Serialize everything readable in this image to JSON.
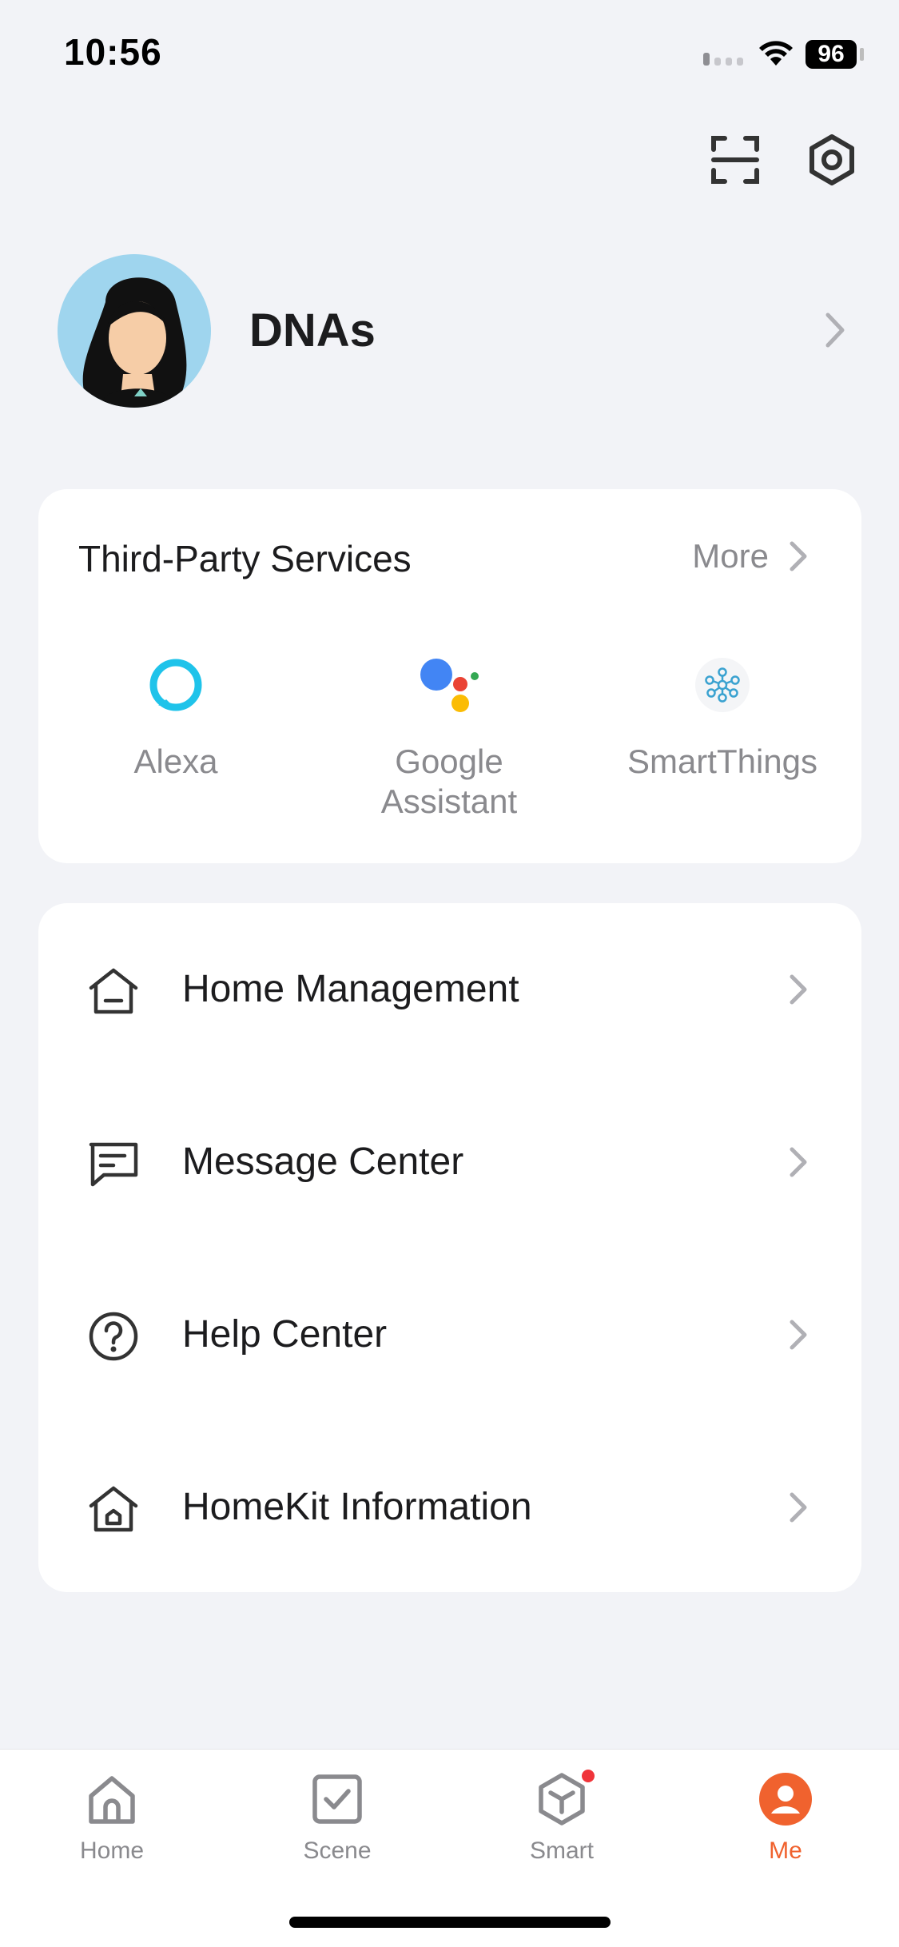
{
  "status_bar": {
    "time": "10:56",
    "battery": "96"
  },
  "profile": {
    "name": "DNAs"
  },
  "third_party": {
    "title": "Third-Party Services",
    "more_label": "More",
    "services": [
      {
        "label": "Alexa",
        "icon": "alexa-icon"
      },
      {
        "label": "Google\nAssistant",
        "icon": "google-assistant-icon"
      },
      {
        "label": "SmartThings",
        "icon": "smartthings-icon"
      }
    ]
  },
  "menu": {
    "items": [
      {
        "label": "Home Management",
        "icon": "home-management-icon"
      },
      {
        "label": "Message Center",
        "icon": "message-icon"
      },
      {
        "label": "Help Center",
        "icon": "help-icon"
      },
      {
        "label": "HomeKit Information",
        "icon": "homekit-icon"
      }
    ]
  },
  "tabs": [
    {
      "label": "Home",
      "icon": "home-tab-icon"
    },
    {
      "label": "Scene",
      "icon": "scene-tab-icon"
    },
    {
      "label": "Smart",
      "icon": "smart-tab-icon",
      "badge": true
    },
    {
      "label": "Me",
      "icon": "me-tab-icon",
      "active": true
    }
  ],
  "colors": {
    "accent": "#f0622e",
    "badge": "#f0343a",
    "background": "#f2f3f7"
  }
}
